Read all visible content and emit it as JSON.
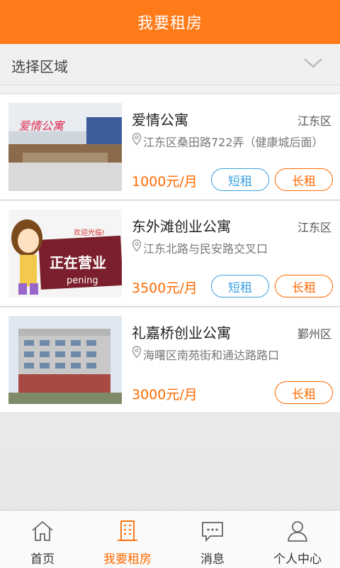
{
  "header": {
    "title": "我要租房"
  },
  "region": {
    "label": "选择区域"
  },
  "listings": [
    {
      "name": "爱情公寓",
      "district": "江东区",
      "address": "江东区桑田路722弄（健康城后面）",
      "price": "1000元/月",
      "short_label": "短租",
      "long_label": "长租",
      "image_text": "爱情公寓"
    },
    {
      "name": "东外滩创业公寓",
      "district": "江东区",
      "address": "江东北路与民安路交叉口",
      "price": "3500元/月",
      "short_label": "短租",
      "long_label": "长租",
      "image_text": "正在营业",
      "image_text2": "欢迎光临!",
      "image_text3": "pening"
    },
    {
      "name": "礼嘉桥创业公寓",
      "district": "鄞州区",
      "address": "海曙区南苑街和通达路路口",
      "price": "3000元/月",
      "long_label": "长租"
    }
  ],
  "tabs": [
    {
      "label": "首页",
      "icon": "home-icon"
    },
    {
      "label": "我要租房",
      "icon": "building-icon"
    },
    {
      "label": "消息",
      "icon": "message-icon"
    },
    {
      "label": "个人中心",
      "icon": "person-icon"
    }
  ],
  "colors": {
    "accent": "#ff7b1a",
    "price": "#ff6a00",
    "short_rent": "#3aa0e0"
  }
}
